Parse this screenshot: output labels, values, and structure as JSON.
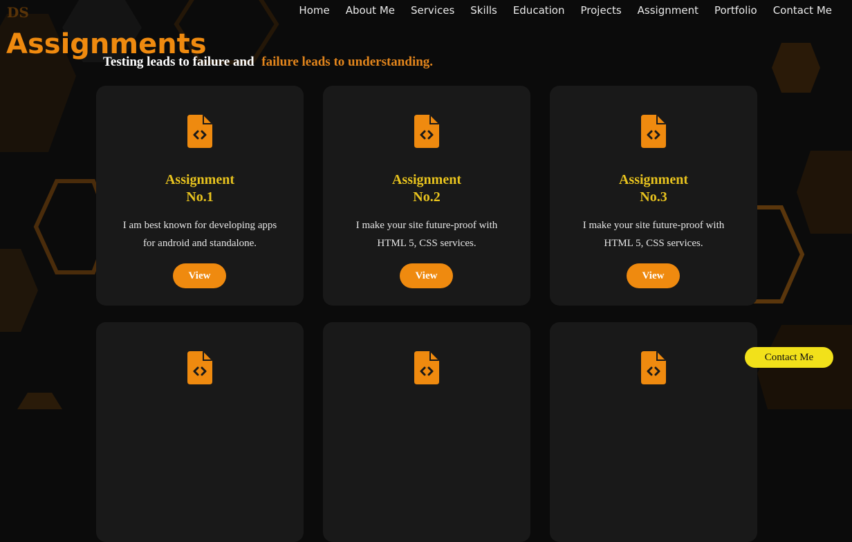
{
  "brand": {
    "logo": "DS"
  },
  "nav": {
    "items": [
      {
        "label": "Home"
      },
      {
        "label": "About Me"
      },
      {
        "label": "Services"
      },
      {
        "label": "Skills"
      },
      {
        "label": "Education"
      },
      {
        "label": "Projects"
      },
      {
        "label": "Assignment"
      },
      {
        "label": "Portfolio"
      },
      {
        "label": "Contact Me"
      }
    ]
  },
  "header": {
    "title": "Assignments",
    "subtitle_part1": "Testing leads to failure and",
    "subtitle_part2": "failure leads to understanding."
  },
  "cards": [
    {
      "icon": "file-code-icon",
      "title_line1": "Assignment",
      "title_line2": "No.1",
      "desc": "I am best known for developing apps for android and standalone.",
      "button": "View"
    },
    {
      "icon": "file-code-icon",
      "title_line1": "Assignment",
      "title_line2": "No.2",
      "desc": "I make your site future-proof with HTML 5, CSS services.",
      "button": "View"
    },
    {
      "icon": "file-code-icon",
      "title_line1": "Assignment",
      "title_line2": "No.3",
      "desc": "I make your site future-proof with HTML 5, CSS services.",
      "button": "View"
    },
    {
      "icon": "file-code-icon",
      "title_line1": "",
      "title_line2": "",
      "desc": "",
      "button": ""
    },
    {
      "icon": "file-code-icon",
      "title_line1": "",
      "title_line2": "",
      "desc": "",
      "button": ""
    },
    {
      "icon": "file-code-icon",
      "title_line1": "",
      "title_line2": "",
      "desc": "",
      "button": ""
    }
  ],
  "floating_button": {
    "label": "Contact Me"
  },
  "colors": {
    "accent_orange": "#ef8a0f",
    "title_yellow": "#e8c31e",
    "contact_yellow": "#f2e11a",
    "card_bg": "#191919",
    "page_bg": "#0b0b0b"
  }
}
